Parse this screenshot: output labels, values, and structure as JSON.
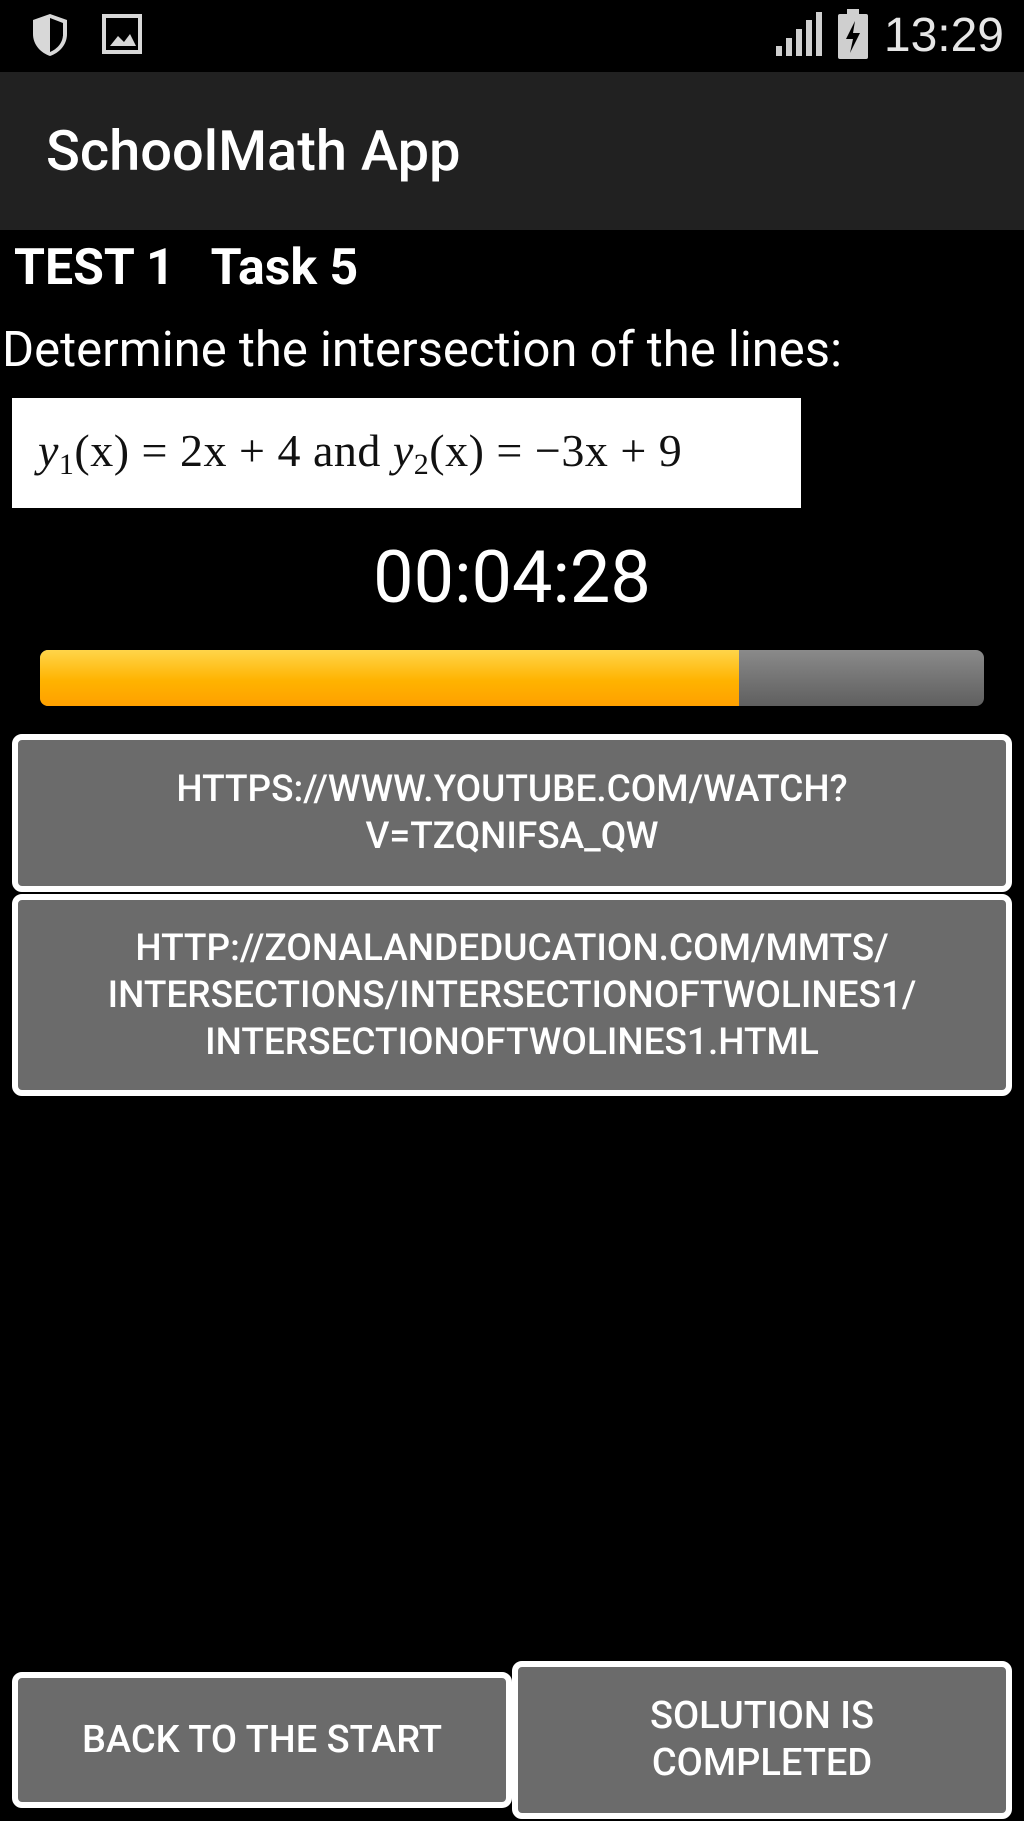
{
  "status_bar": {
    "time": "13:29",
    "left_icons": [
      "shield-icon",
      "image-icon"
    ],
    "right_icons": [
      "signal-icon",
      "battery-charging-icon"
    ]
  },
  "app_bar": {
    "title": "SchoolMath App"
  },
  "task": {
    "header": "TEST 1   Task 5",
    "prompt": "Determine the intersection of the lines:",
    "formula": {
      "y1_label": "y",
      "y1_sub": "1",
      "y1_expr": "(x) = 2x + 4",
      "conjunction": "and",
      "y2_label": "y",
      "y2_sub": "2",
      "y2_expr": "(x) = −3x + 9"
    }
  },
  "timer": {
    "value": "00:04:28",
    "progress_percent": 74,
    "fill_color": "#ffb300"
  },
  "links": [
    {
      "label": "HTTPS://WWW.YOUTUBE.COM/WATCH?\nV=TZQNIFSA_QW"
    },
    {
      "label": "HTTP://ZONALANDEDUCATION.COM/MMTS/\nINTERSECTIONS/INTERSECTIONOFTWOLINES1/\nINTERSECTIONOFTWOLINES1.HTML"
    }
  ],
  "footer": {
    "back_label": "BACK TO THE START",
    "completed_label": "SOLUTION IS\nCOMPLETED"
  }
}
